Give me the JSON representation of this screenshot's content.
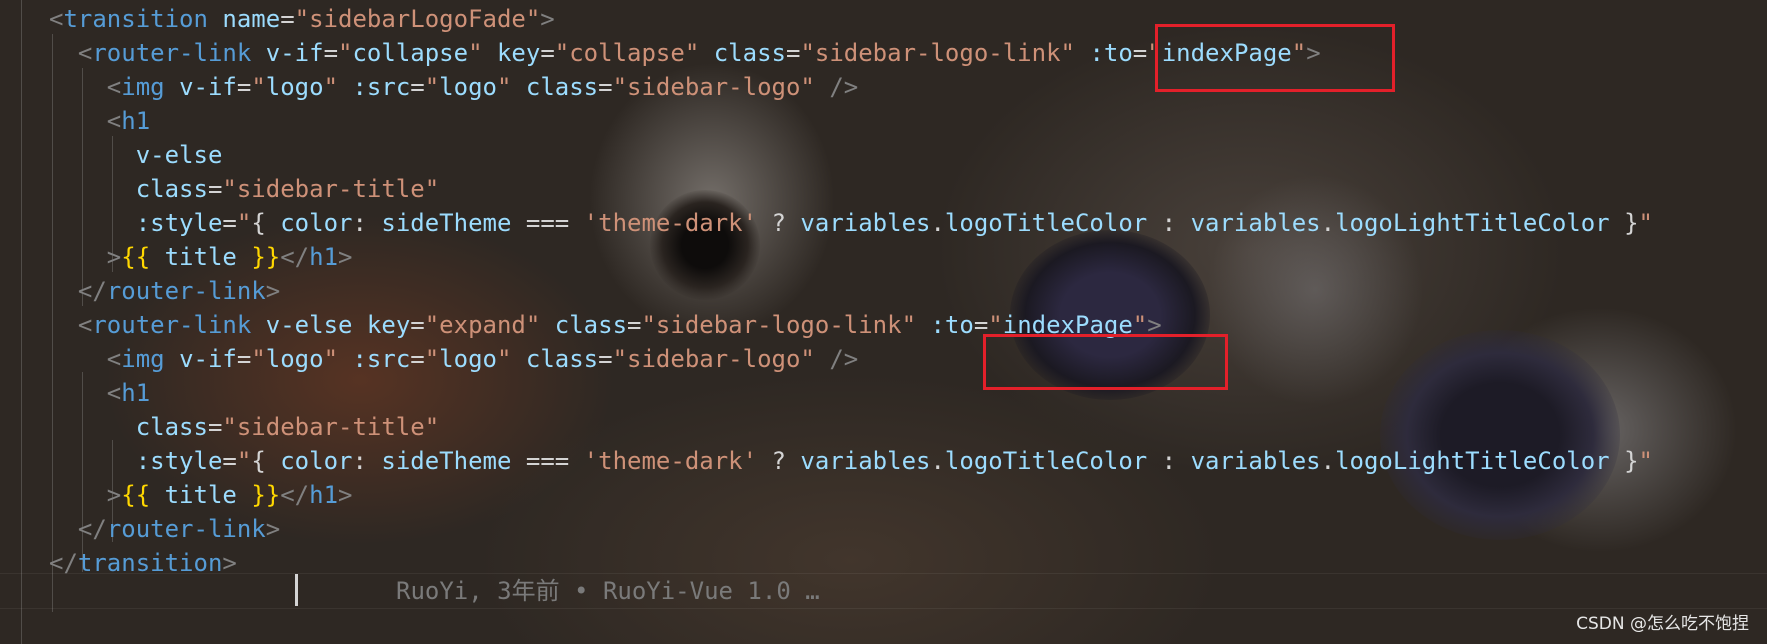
{
  "editor": {
    "lines": [
      [
        [
          "tok-bracket",
          "<"
        ],
        [
          "tok-tag",
          "transition"
        ],
        [
          "tok-default",
          " "
        ],
        [
          "tok-attr",
          "name"
        ],
        [
          "tok-default",
          "="
        ],
        [
          "tok-str",
          "\"sidebarLogoFade\""
        ],
        [
          "tok-bracket",
          ">"
        ]
      ],
      [
        [
          "tok-default",
          "  "
        ],
        [
          "tok-bracket",
          "<"
        ],
        [
          "tok-tag",
          "router-link"
        ],
        [
          "tok-default",
          " "
        ],
        [
          "tok-attr",
          "v-if"
        ],
        [
          "tok-default",
          "="
        ],
        [
          "tok-str",
          "\""
        ],
        [
          "tok-expr",
          "collapse"
        ],
        [
          "tok-str",
          "\""
        ],
        [
          "tok-default",
          " "
        ],
        [
          "tok-attr",
          "key"
        ],
        [
          "tok-default",
          "="
        ],
        [
          "tok-str",
          "\"collapse\""
        ],
        [
          "tok-default",
          " "
        ],
        [
          "tok-attr",
          "class"
        ],
        [
          "tok-default",
          "="
        ],
        [
          "tok-str",
          "\"sidebar-logo-link\""
        ],
        [
          "tok-default",
          " "
        ],
        [
          "tok-attr",
          ":to"
        ],
        [
          "tok-default",
          "="
        ],
        [
          "tok-str",
          "\""
        ],
        [
          "tok-expr",
          "indexPage"
        ],
        [
          "tok-str",
          "\""
        ],
        [
          "tok-bracket",
          ">"
        ]
      ],
      [
        [
          "tok-default",
          "    "
        ],
        [
          "tok-bracket",
          "<"
        ],
        [
          "tok-tag",
          "img"
        ],
        [
          "tok-default",
          " "
        ],
        [
          "tok-attr",
          "v-if"
        ],
        [
          "tok-default",
          "="
        ],
        [
          "tok-str",
          "\""
        ],
        [
          "tok-expr",
          "logo"
        ],
        [
          "tok-str",
          "\""
        ],
        [
          "tok-default",
          " "
        ],
        [
          "tok-attr",
          ":src"
        ],
        [
          "tok-default",
          "="
        ],
        [
          "tok-str",
          "\""
        ],
        [
          "tok-expr",
          "logo"
        ],
        [
          "tok-str",
          "\""
        ],
        [
          "tok-default",
          " "
        ],
        [
          "tok-attr",
          "class"
        ],
        [
          "tok-default",
          "="
        ],
        [
          "tok-str",
          "\"sidebar-logo\""
        ],
        [
          "tok-default",
          " "
        ],
        [
          "tok-bracket",
          "/>"
        ]
      ],
      [
        [
          "tok-default",
          "    "
        ],
        [
          "tok-bracket",
          "<"
        ],
        [
          "tok-tag",
          "h1"
        ]
      ],
      [
        [
          "tok-default",
          "      "
        ],
        [
          "tok-attr",
          "v-else"
        ]
      ],
      [
        [
          "tok-default",
          "      "
        ],
        [
          "tok-attr",
          "class"
        ],
        [
          "tok-default",
          "="
        ],
        [
          "tok-str",
          "\"sidebar-title\""
        ]
      ],
      [
        [
          "tok-default",
          "      "
        ],
        [
          "tok-attr",
          ":style"
        ],
        [
          "tok-default",
          "="
        ],
        [
          "tok-str",
          "\""
        ],
        [
          "tok-default",
          "{ "
        ],
        [
          "tok-expr",
          "color"
        ],
        [
          "tok-default",
          ": "
        ],
        [
          "tok-expr",
          "sideTheme"
        ],
        [
          "tok-default",
          " === "
        ],
        [
          "tok-str",
          "'theme-dark'"
        ],
        [
          "tok-default",
          " ? "
        ],
        [
          "tok-expr",
          "variables"
        ],
        [
          "tok-default",
          "."
        ],
        [
          "tok-expr",
          "logoTitleColor"
        ],
        [
          "tok-default",
          " : "
        ],
        [
          "tok-expr",
          "variables"
        ],
        [
          "tok-default",
          "."
        ],
        [
          "tok-expr",
          "logoLightTitleColor"
        ],
        [
          "tok-default",
          " }"
        ],
        [
          "tok-str",
          "\""
        ]
      ],
      [
        [
          "tok-default",
          "    "
        ],
        [
          "tok-bracket",
          ">"
        ],
        [
          "tok-brace",
          "{{"
        ],
        [
          "tok-default",
          " "
        ],
        [
          "tok-expr",
          "title"
        ],
        [
          "tok-default",
          " "
        ],
        [
          "tok-brace",
          "}}"
        ],
        [
          "tok-bracket",
          "</"
        ],
        [
          "tok-tag",
          "h1"
        ],
        [
          "tok-bracket",
          ">"
        ]
      ],
      [
        [
          "tok-default",
          "  "
        ],
        [
          "tok-bracket",
          "</"
        ],
        [
          "tok-tag",
          "router-link"
        ],
        [
          "tok-bracket",
          ">"
        ]
      ],
      [
        [
          "tok-default",
          "  "
        ],
        [
          "tok-bracket",
          "<"
        ],
        [
          "tok-tag",
          "router-link"
        ],
        [
          "tok-default",
          " "
        ],
        [
          "tok-attr",
          "v-else"
        ],
        [
          "tok-default",
          " "
        ],
        [
          "tok-attr",
          "key"
        ],
        [
          "tok-default",
          "="
        ],
        [
          "tok-str",
          "\"expand\""
        ],
        [
          "tok-default",
          " "
        ],
        [
          "tok-attr",
          "class"
        ],
        [
          "tok-default",
          "="
        ],
        [
          "tok-str",
          "\"sidebar-logo-link\""
        ],
        [
          "tok-default",
          " "
        ],
        [
          "tok-attr",
          ":to"
        ],
        [
          "tok-default",
          "="
        ],
        [
          "tok-str",
          "\""
        ],
        [
          "tok-expr",
          "indexPage"
        ],
        [
          "tok-str",
          "\""
        ],
        [
          "tok-bracket",
          ">"
        ]
      ],
      [
        [
          "tok-default",
          "    "
        ],
        [
          "tok-bracket",
          "<"
        ],
        [
          "tok-tag",
          "img"
        ],
        [
          "tok-default",
          " "
        ],
        [
          "tok-attr",
          "v-if"
        ],
        [
          "tok-default",
          "="
        ],
        [
          "tok-str",
          "\""
        ],
        [
          "tok-expr",
          "logo"
        ],
        [
          "tok-str",
          "\""
        ],
        [
          "tok-default",
          " "
        ],
        [
          "tok-attr",
          ":src"
        ],
        [
          "tok-default",
          "="
        ],
        [
          "tok-str",
          "\""
        ],
        [
          "tok-expr",
          "logo"
        ],
        [
          "tok-str",
          "\""
        ],
        [
          "tok-default",
          " "
        ],
        [
          "tok-attr",
          "class"
        ],
        [
          "tok-default",
          "="
        ],
        [
          "tok-str",
          "\"sidebar-logo\""
        ],
        [
          "tok-default",
          " "
        ],
        [
          "tok-bracket",
          "/>"
        ]
      ],
      [
        [
          "tok-default",
          "    "
        ],
        [
          "tok-bracket",
          "<"
        ],
        [
          "tok-tag",
          "h1"
        ]
      ],
      [
        [
          "tok-default",
          "      "
        ],
        [
          "tok-attr",
          "class"
        ],
        [
          "tok-default",
          "="
        ],
        [
          "tok-str",
          "\"sidebar-title\""
        ]
      ],
      [
        [
          "tok-default",
          "      "
        ],
        [
          "tok-attr",
          ":style"
        ],
        [
          "tok-default",
          "="
        ],
        [
          "tok-str",
          "\""
        ],
        [
          "tok-default",
          "{ "
        ],
        [
          "tok-expr",
          "color"
        ],
        [
          "tok-default",
          ": "
        ],
        [
          "tok-expr",
          "sideTheme"
        ],
        [
          "tok-default",
          " === "
        ],
        [
          "tok-str",
          "'theme-dark'"
        ],
        [
          "tok-default",
          " ? "
        ],
        [
          "tok-expr",
          "variables"
        ],
        [
          "tok-default",
          "."
        ],
        [
          "tok-expr",
          "logoTitleColor"
        ],
        [
          "tok-default",
          " : "
        ],
        [
          "tok-expr",
          "variables"
        ],
        [
          "tok-default",
          "."
        ],
        [
          "tok-expr",
          "logoLightTitleColor"
        ],
        [
          "tok-default",
          " }"
        ],
        [
          "tok-str",
          "\""
        ]
      ],
      [
        [
          "tok-default",
          "    "
        ],
        [
          "tok-bracket",
          ">"
        ],
        [
          "tok-brace",
          "{{"
        ],
        [
          "tok-default",
          " "
        ],
        [
          "tok-expr",
          "title"
        ],
        [
          "tok-default",
          " "
        ],
        [
          "tok-brace",
          "}}"
        ],
        [
          "tok-bracket",
          "</"
        ],
        [
          "tok-tag",
          "h1"
        ],
        [
          "tok-bracket",
          ">"
        ]
      ],
      [
        [
          "tok-default",
          "  "
        ],
        [
          "tok-bracket",
          "</"
        ],
        [
          "tok-tag",
          "router-link"
        ],
        [
          "tok-bracket",
          ">"
        ]
      ],
      [
        [
          "tok-bracket",
          "</"
        ],
        [
          "tok-tag",
          "transition"
        ],
        [
          "tok-bracket",
          ">"
        ]
      ]
    ],
    "blame": "RuoYi, 3年前 • RuoYi-Vue 1.0 …"
  },
  "watermark": "CSDN @怎么吃不饱捏",
  "colors": {
    "highlight": "#e3202a",
    "tag": "#569cd6",
    "attribute": "#9cdcfe",
    "string": "#ce9178"
  }
}
